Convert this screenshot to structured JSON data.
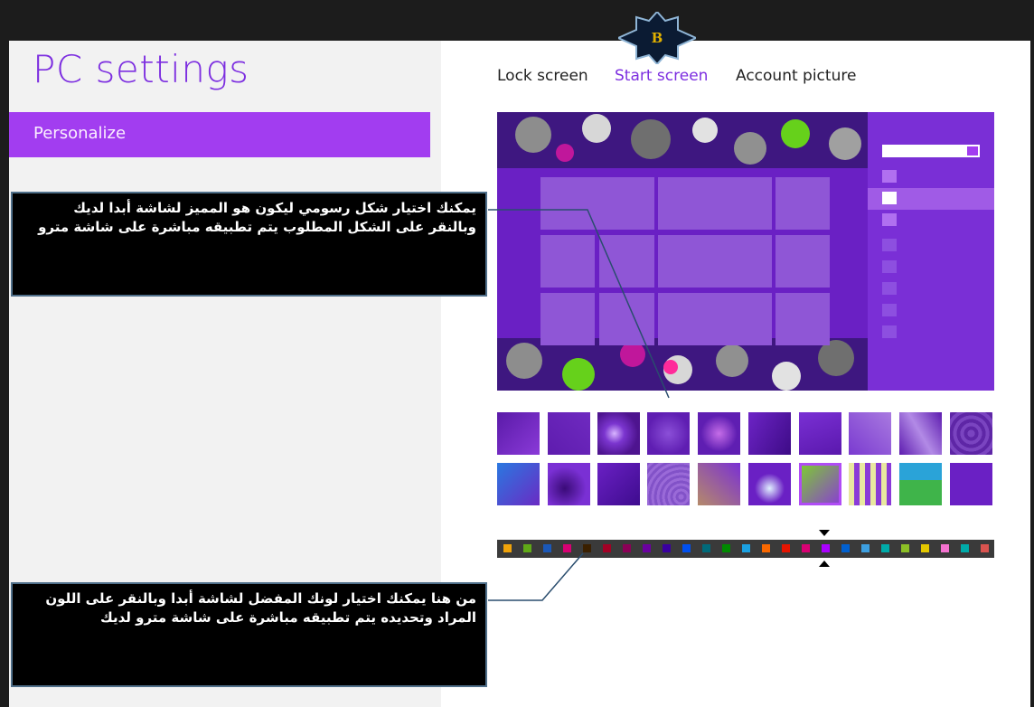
{
  "app": {
    "title": "PC settings"
  },
  "sidebar": {
    "selected_category": "Personalize"
  },
  "tabs": [
    {
      "label": "Lock screen",
      "active": false
    },
    {
      "label": "Start screen",
      "active": true
    },
    {
      "label": "Account picture",
      "active": false
    }
  ],
  "badge": {
    "label": "B"
  },
  "callouts": {
    "pattern": "يمكنك اختيار شكل رسومي ليكون هو المميز لشاشة أبدا لديك وبالنقر على الشكل المطلوب يتم تطبيقه مباشرة على شاشة مترو",
    "color": "من هنا يمكنك اختيار لونك المفضل لشاشة أبدا وبالنقر على اللون المراد وتحديده يتم تطبيقه مباشرة على شاشة مترو لديك"
  },
  "colors": {
    "accent": "#a23df0",
    "title": "#7d2fe0",
    "tab_active": "#7d2fe0",
    "tab_inactive": "#222222",
    "color_swatches": [
      "#f0a30a",
      "#60a917",
      "#1b58b8",
      "#d80073",
      "#3a1f00",
      "#a20025",
      "#8b0057",
      "#6a00a0",
      "#3a00a0",
      "#0050ef",
      "#006a7a",
      "#008a00",
      "#1ba1e2",
      "#fa6800",
      "#e51400",
      "#d80073",
      "#aa00ff",
      "#0060cf",
      "#3d9fe0",
      "#00aba9",
      "#8cbf26",
      "#e3c800",
      "#f472d0",
      "#00aba9",
      "#d9534f"
    ]
  },
  "patterns": {
    "selected_index": 18
  }
}
